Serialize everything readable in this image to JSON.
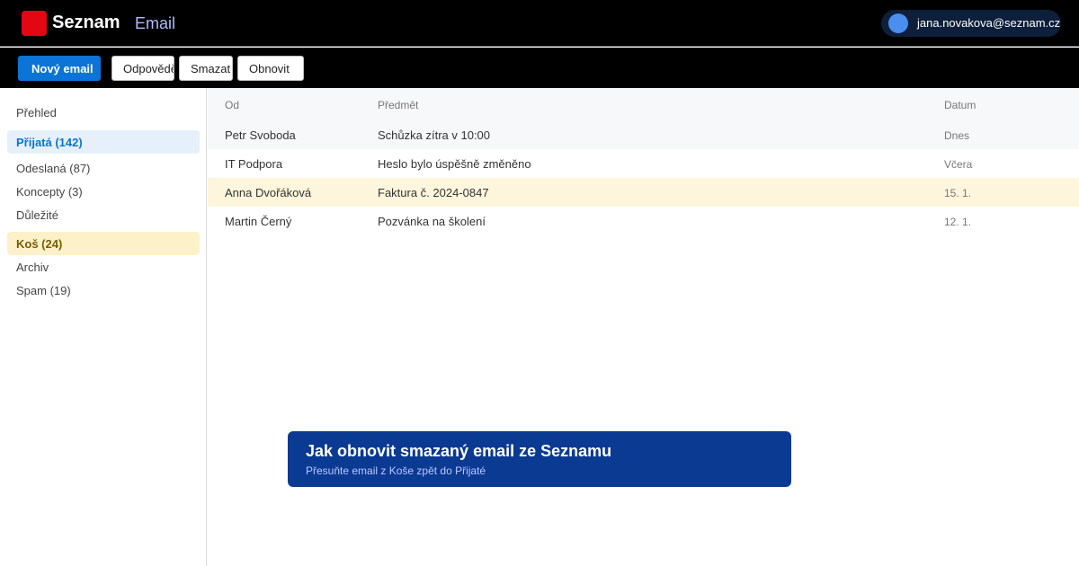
{
  "header": {
    "logo_text": "Seznam",
    "app_name": "Email",
    "account_email": "jana.novakova@seznam.cz"
  },
  "toolbar": {
    "new_email": "Nový email",
    "reply": "Odpovědět",
    "delete": "Smazat",
    "restore": "Obnovit"
  },
  "sidebar": {
    "items": [
      {
        "label": "Přehled"
      },
      {
        "label": "Přijatá (142)"
      },
      {
        "label": "Odeslaná (87)"
      },
      {
        "label": "Koncepty (3)"
      },
      {
        "label": "Důležité"
      },
      {
        "label": "Koš (24)"
      },
      {
        "label": "Archiv"
      },
      {
        "label": "Spam (19)"
      }
    ]
  },
  "list": {
    "columns": {
      "from": "Od",
      "subject": "Předmět",
      "date": "Datum"
    },
    "rows": [
      {
        "from": "Petr Svoboda",
        "subject": "Schůzka zítra v 10:00",
        "date": "Dnes"
      },
      {
        "from": "IT Podpora",
        "subject": "Heslo bylo úspěšně změněno",
        "date": "Včera"
      },
      {
        "from": "Anna Dvořáková",
        "subject": "Faktura č. 2024-0847",
        "date": "15. 1."
      },
      {
        "from": "Martin Černý",
        "subject": "Pozvánka na školení",
        "date": "12. 1."
      }
    ]
  },
  "banner": {
    "title": "Jak obnovit smazaný email ze Seznamu",
    "subtitle": "Přesuňte email z Koše zpět do Přijaté"
  },
  "colors": {
    "brand_red": "#e30613",
    "primary_blue": "#0b74d6",
    "banner_blue": "#0b3a93",
    "highlight_row": "#fdf6dc"
  }
}
